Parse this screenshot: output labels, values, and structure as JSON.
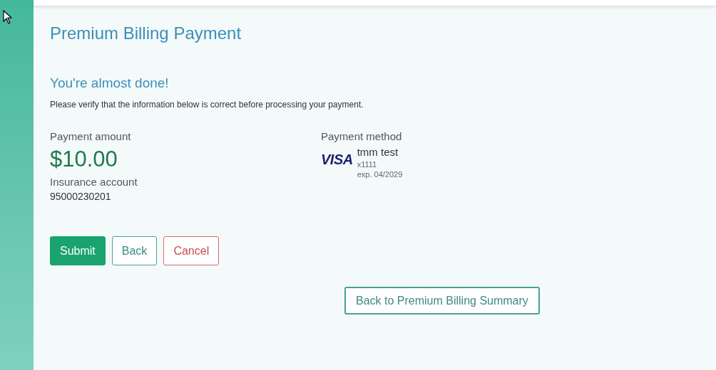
{
  "page": {
    "title": "Premium Billing Payment"
  },
  "confirmation": {
    "heading": "You're almost done!",
    "instructions": "Please verify that the information below is correct before processing your payment."
  },
  "payment_amount": {
    "label": "Payment amount",
    "amount": "$10.00",
    "account_label": "Insurance account",
    "account_number": "95000230201"
  },
  "payment_method": {
    "label": "Payment method",
    "card_brand": "VISA",
    "card_name": "tmm test",
    "card_number": "x1111",
    "expiry": "exp. 04/2029"
  },
  "buttons": [
    {
      "label": "Submit",
      "kind": "primary"
    },
    {
      "label": "Back",
      "kind": "outline"
    },
    {
      "label": "Cancel",
      "kind": "danger"
    }
  ],
  "summary_link": {
    "label": "Back to Premium Billing Summary"
  }
}
